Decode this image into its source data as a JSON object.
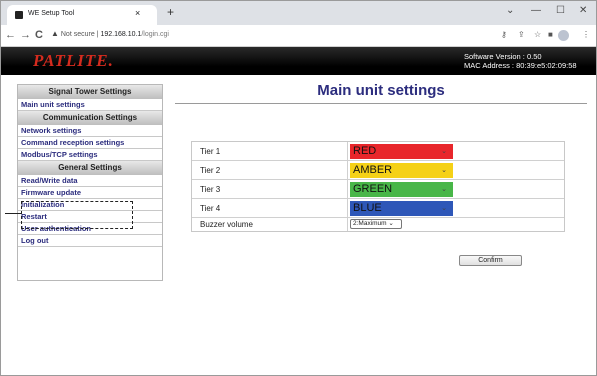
{
  "browser": {
    "tab_title": "WE Setup Tool",
    "tab_close": "×",
    "new_tab": "+",
    "win_min": "—",
    "win_max": "☐",
    "win_close": "✕",
    "win_chevron": "⌄",
    "nav_back": "←",
    "nav_forward": "→",
    "nav_reload": "C",
    "security_label": "Not secure",
    "url_host": "192.168.10.1",
    "url_path": "/login.cgi"
  },
  "header": {
    "logo": "PATLITE.",
    "software_version": "Software Version : 0.50",
    "mac_address": "MAC Address : 80:39:e5:02:09:58"
  },
  "sidebar": {
    "sections": [
      {
        "title": "Signal Tower Settings",
        "items": [
          "Main unit settings"
        ]
      },
      {
        "title": "Communication Settings",
        "items": [
          "Network settings",
          "Command reception settings",
          "Modbus/TCP settings"
        ]
      },
      {
        "title": "General Settings",
        "items": [
          "Read/Write data",
          "Firmware update",
          "Initialization",
          "Restart",
          "User authentication",
          "Log out"
        ]
      }
    ]
  },
  "main": {
    "title": "Main unit settings",
    "tiers": [
      {
        "label": "Tier 1",
        "value": "RED",
        "color": "#e8262b"
      },
      {
        "label": "Tier 2",
        "value": "AMBER",
        "color": "#f5d117"
      },
      {
        "label": "Tier 3",
        "value": "GREEN",
        "color": "#48b648"
      },
      {
        "label": "Tier 4",
        "value": "BLUE",
        "color": "#2e57b8"
      }
    ],
    "buzzer_label": "Buzzer volume",
    "buzzer_value": "2:Maximum",
    "confirm_label": "Confirm"
  }
}
